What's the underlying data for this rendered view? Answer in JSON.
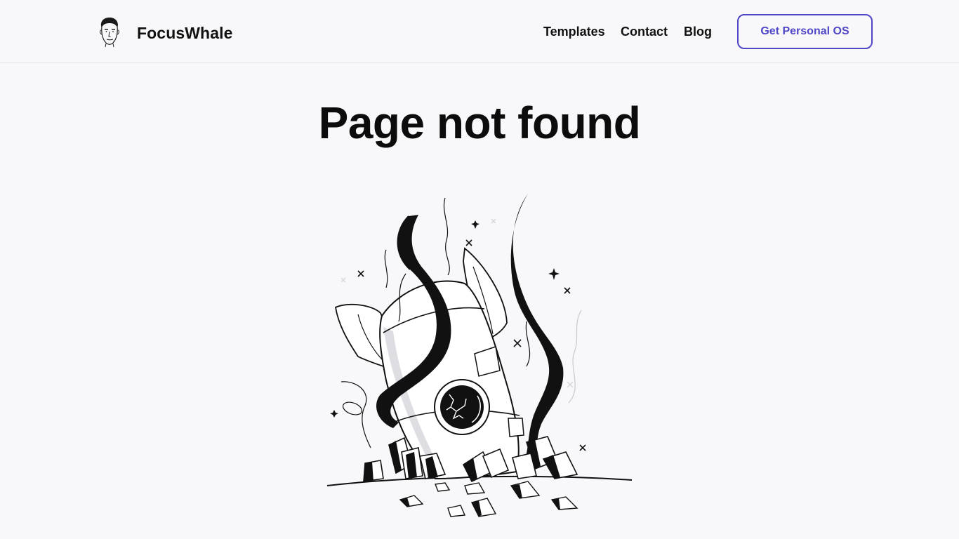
{
  "header": {
    "brand": {
      "name": "FocusWhale",
      "logo_icon": "face-avatar-icon"
    },
    "nav": [
      {
        "label": "Templates"
      },
      {
        "label": "Contact"
      },
      {
        "label": "Blog"
      }
    ],
    "cta_label": "Get Personal OS"
  },
  "main": {
    "title": "Page not found",
    "illustration": "crashed-rocket-illustration"
  },
  "colors": {
    "accent": "#4f46c8",
    "background": "#f8f8fa",
    "text": "#111111",
    "divider": "#e3e3e8"
  }
}
